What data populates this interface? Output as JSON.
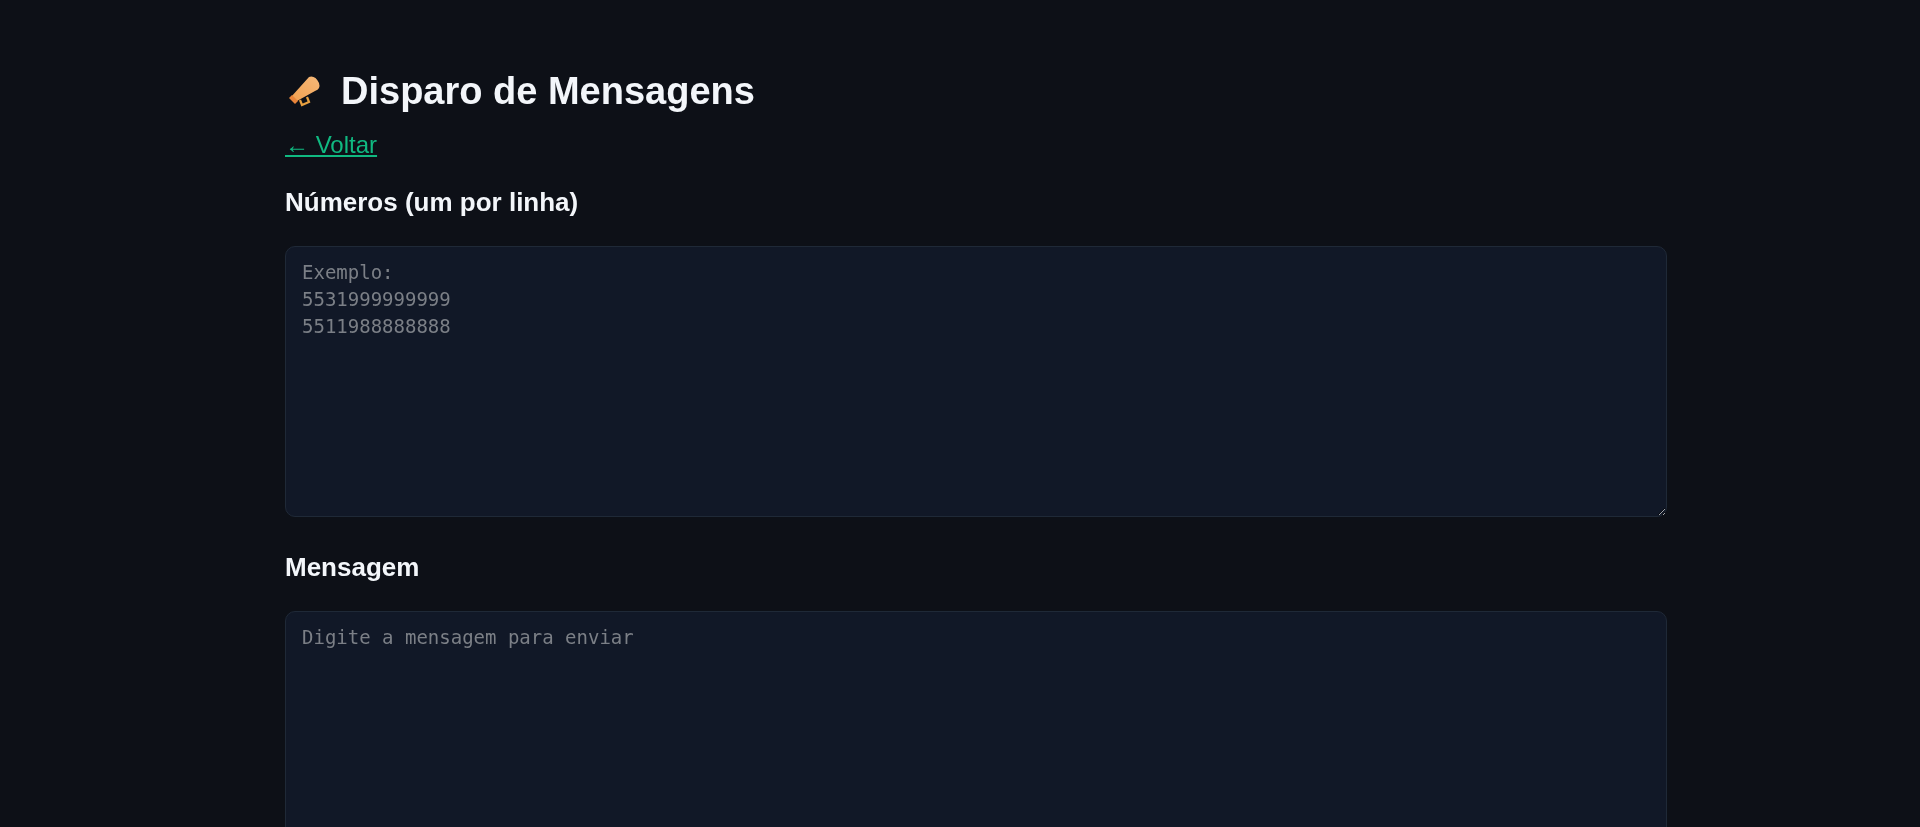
{
  "page": {
    "title": "Disparo de Mensagens",
    "back_link": "← Voltar"
  },
  "fields": [
    {
      "label": "Números (um por linha)",
      "placeholder": "Exemplo:\n5531999999999\n5511988888888"
    },
    {
      "label": "Mensagem",
      "placeholder": "Digite a mensagem para enviar"
    }
  ]
}
